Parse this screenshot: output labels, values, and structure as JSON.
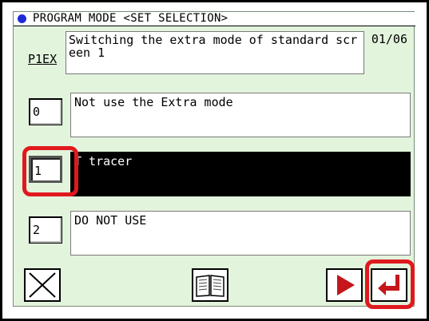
{
  "window": {
    "title": "PROGRAM MODE <SET SELECTION>",
    "page_indicator": "01/06"
  },
  "parameter": {
    "code": "P1EX",
    "description": "Switching the extra mode of standard screen 1"
  },
  "options": [
    {
      "number": "0",
      "label": "Not use the Extra mode",
      "selected": false
    },
    {
      "number": "1",
      "label": "T tracer",
      "selected": true
    },
    {
      "number": "2",
      "label": "DO NOT USE",
      "selected": false
    }
  ],
  "toolbar": {
    "cancel_icon": "close-icon",
    "manual_icon": "book-icon",
    "next_icon": "play-icon",
    "enter_icon": "enter-icon"
  },
  "colors": {
    "panel_bg": "#e3f4dd",
    "title_dot": "#1d2bd6",
    "selected_bg": "#000000",
    "highlight": "#e0191f",
    "arrow": "#c4161c"
  }
}
